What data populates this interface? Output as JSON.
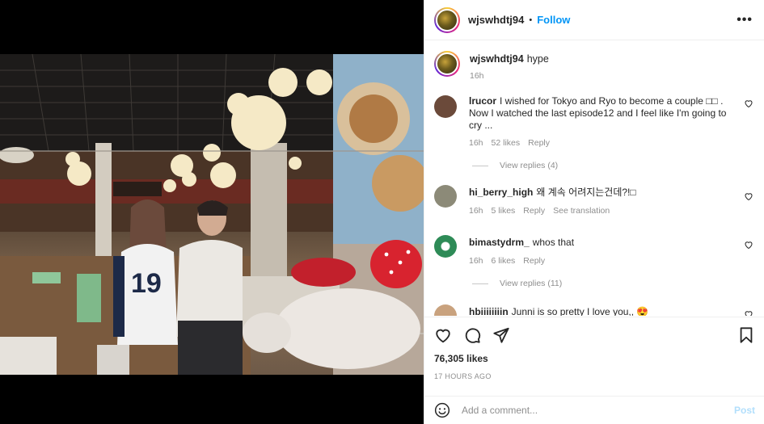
{
  "post": {
    "username": "wjswhdtj94",
    "separator": "•",
    "follow_label": "Follow",
    "more_label": "•••",
    "caption": {
      "username": "wjswhdtj94",
      "text": "hype",
      "time": "16h"
    },
    "likes": "76,305 likes",
    "date": "17 HOURS AGO"
  },
  "comments": [
    {
      "username": "lrucor",
      "text": "I wished for Tokyo and Ryo to become a couple □□ . Now I watched the last episode12 and I feel like I'm going to cry ...",
      "time": "16h",
      "likes": "52 likes",
      "reply": "Reply",
      "view_replies": "View replies (4)",
      "avatar_color": "#6b4a3a"
    },
    {
      "username": "hi_berry_high",
      "text": "왜 계속 어려지는건데?!□",
      "time": "16h",
      "likes": "5 likes",
      "reply": "Reply",
      "translate": "See translation",
      "avatar_color": "#8c8a78"
    },
    {
      "username": "bimastydrm_",
      "text": "whos that",
      "time": "16h",
      "likes": "6 likes",
      "reply": "Reply",
      "view_replies": "View replies (11)",
      "avatar_color": "#2e8b57"
    },
    {
      "username": "hbiiiiiiiin",
      "text": "Junni is so pretty I love you,,",
      "emoji": "😍",
      "avatar_color": "#c9a27e"
    }
  ],
  "composer": {
    "placeholder": "Add a comment...",
    "post_label": "Post"
  },
  "colors": {
    "accent": "#0095f6",
    "muted": "#8e8e8e",
    "post_disabled": "#b2dffc"
  }
}
